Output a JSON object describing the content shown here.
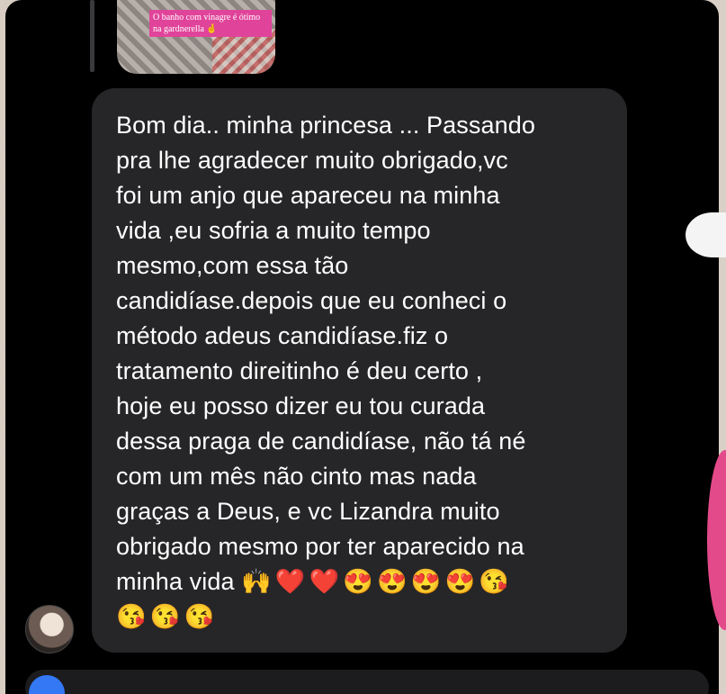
{
  "story_reply": {
    "caption": "O banho com vinagre é ótimo na gardnerella 🤞"
  },
  "message": {
    "lines": "Bom dia.. minha princesa ... Passando\npra lhe agradecer muito obrigado,vc\nfoi um anjo que apareceu na minha\nvida ,eu sofria a muito tempo\nmesmo,com essa tão\ncandidíase.depois que eu conheci o\nmétodo adeus candidíase.fiz  o\ntratamento direitinho é deu certo ,\nhoje eu posso dizer eu tou curada\ndessa praga de candidíase, não tá né\ncom um mês não cinto mas nada\ngraças a Deus, e vc Lizandra muito\nobrigado mesmo por ter aparecido na\nminha vida",
    "emojis": [
      "🙌",
      "❤️",
      "❤️",
      "😍",
      "😍",
      "😍",
      "😍",
      "😘",
      "😘",
      "😘",
      "😘"
    ]
  },
  "colors": {
    "bubble": "#262628",
    "background": "#000000",
    "accent": "#3478f6"
  }
}
